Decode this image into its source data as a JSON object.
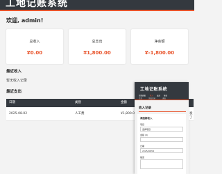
{
  "header": {
    "title": "工地记账系统"
  },
  "welcome": "欢迎, admin!",
  "cards": [
    {
      "label": "总收入",
      "value": "¥0.00"
    },
    {
      "label": "总支出",
      "value": "¥1,800.00"
    },
    {
      "label": "净余额",
      "value": "¥-1,800.00"
    }
  ],
  "recent_income": {
    "title": "最近收入",
    "empty_text": "暂无收入记录"
  },
  "recent_expense": {
    "title": "最近支出",
    "columns": [
      "日期",
      "类别",
      "金额"
    ],
    "rows": [
      {
        "date": "2025-08-02",
        "category": "人工费",
        "amount": "¥1,800.0"
      }
    ]
  },
  "edge_text": "发了",
  "overlay": {
    "title": "工地记账系统",
    "nav": [
      "控制面板",
      "收入",
      "支出",
      "报表"
    ],
    "sub": [
      "主页",
      "添加记录",
      "退出"
    ],
    "page_title": "收入记录",
    "form_title": "添加新收入",
    "fields": [
      {
        "label": "项目",
        "value": "选择项目"
      },
      {
        "label": "金额 (¥)",
        "value": ""
      },
      {
        "label": "日期",
        "value": "2025/08/02"
      },
      {
        "label": "描述",
        "value": ""
      }
    ]
  },
  "colors": {
    "header_bg": "#34393f",
    "accent": "#e8532a",
    "page_bg": "#f3f3f3"
  }
}
